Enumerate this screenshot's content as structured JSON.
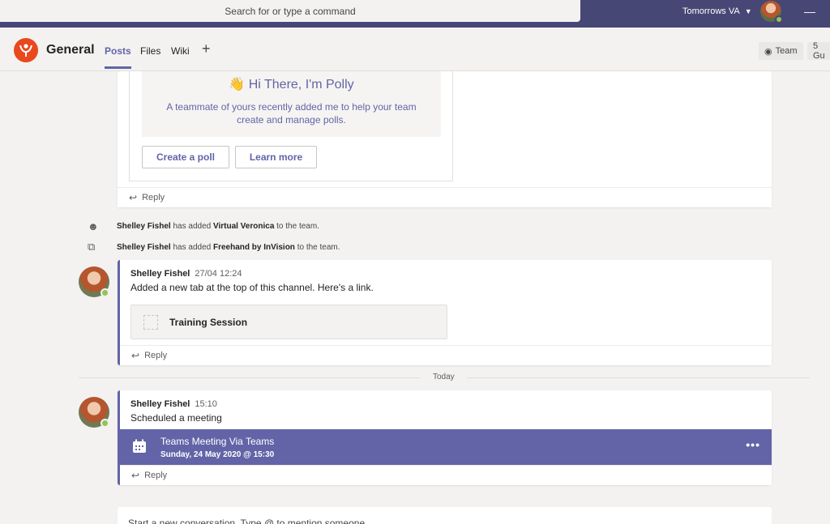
{
  "topbar": {
    "search_placeholder": "Search for or type a command",
    "tenant": "Tomorrows VA",
    "minimize": "—"
  },
  "channel": {
    "name": "General",
    "tabs": [
      {
        "label": "Posts"
      },
      {
        "label": "Files"
      },
      {
        "label": "Wiki"
      }
    ],
    "add_tab": "+",
    "team_button": "Team",
    "guests_button": "5 Gu"
  },
  "polly": {
    "title": "Hi There, I'm Polly",
    "wave": "👋",
    "description": "A teammate of yours recently added me to help your team create and manage polls.",
    "create_label": "Create a poll",
    "learn_label": "Learn more"
  },
  "reply_label": "Reply",
  "system_messages": [
    {
      "actor": "Shelley Fishel",
      "action": " has added ",
      "target": "Virtual Veronica",
      "suffix": " to the team."
    },
    {
      "actor": "Shelley Fishel",
      "action": " has added ",
      "target": "Freehand by InVision",
      "suffix": " to the team."
    }
  ],
  "message1": {
    "author": "Shelley Fishel",
    "time": "27/04 12:24",
    "text": "Added a new tab at the top of this channel. Here's a link.",
    "tab_card_title": "Training Session"
  },
  "divider_label": "Today",
  "message2": {
    "author": "Shelley Fishel",
    "time": "15:10",
    "text": "Scheduled a meeting",
    "meeting_title": "Teams Meeting Via Teams",
    "meeting_date": "Sunday, 24 May 2020 @ 15:30",
    "more": "•••"
  },
  "composer_placeholder": "Start a new conversation. Type @ to mention someone.",
  "colors": {
    "brand": "#6264a7",
    "titlebar": "#464775",
    "presence": "#92c353",
    "team_logo": "#e8491d"
  }
}
